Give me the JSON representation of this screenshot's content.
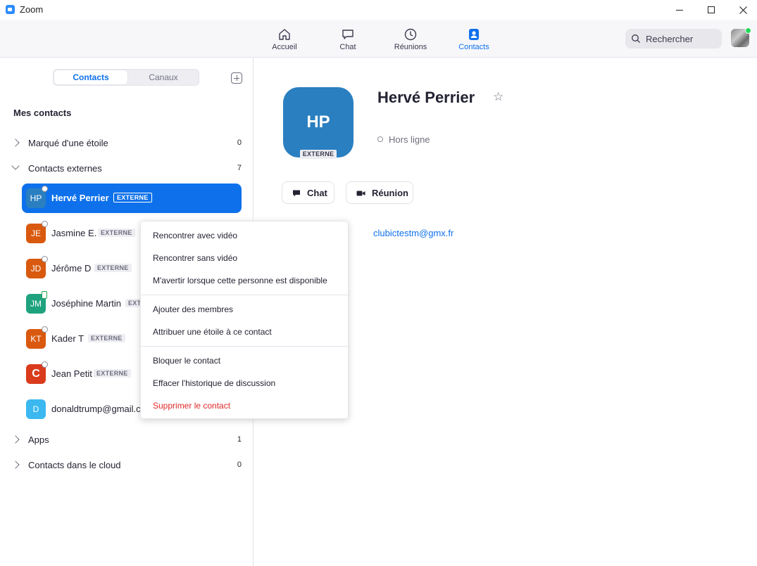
{
  "window": {
    "title": "Zoom"
  },
  "nav": {
    "tabs": [
      {
        "label": "Accueil",
        "icon": "home-icon"
      },
      {
        "label": "Chat",
        "icon": "chat-icon"
      },
      {
        "label": "Réunions",
        "icon": "clock-icon"
      },
      {
        "label": "Contacts",
        "icon": "contacts-icon",
        "active": true
      }
    ],
    "search_label": "Rechercher"
  },
  "sidebar": {
    "segments": [
      "Contacts",
      "Canaux"
    ],
    "section_title": "Mes contacts",
    "groups": {
      "starred": {
        "label": "Marqué d'une étoile",
        "count": "0"
      },
      "external": {
        "label": "Contacts externes",
        "count": "7"
      },
      "apps": {
        "label": "Apps",
        "count": "1"
      },
      "cloud": {
        "label": "Contacts dans le cloud",
        "count": "0"
      }
    },
    "contacts": [
      {
        "initials": "HP",
        "name": "Hervé Perrier",
        "tag": "EXTERNE",
        "color": "#2a7fc0"
      },
      {
        "initials": "JE",
        "name": "Jasmine E.",
        "tag": "EXTERNE",
        "color": "#d9590f"
      },
      {
        "initials": "JD",
        "name": "Jérôme D",
        "tag": "EXTERNE",
        "color": "#d9590f"
      },
      {
        "initials": "JM",
        "name": "Joséphine Martin",
        "tag": "EXT",
        "color": "#1fa37f"
      },
      {
        "initials": "KT",
        "name": "Kader T",
        "tag": "EXTERNE",
        "color": "#d9590f"
      },
      {
        "initials": "C",
        "name": "Jean Petit",
        "tag": "EXTERNE",
        "color": "#d93b1c"
      },
      {
        "initials": "D",
        "name": "donaldtrump@gmail.c",
        "tag": "",
        "color": "#3bb8f0"
      }
    ]
  },
  "profile": {
    "initials": "HP",
    "tag": "EXTERNE",
    "name": "Hervé Perrier",
    "presence": "Hors ligne",
    "chat_button": "Chat",
    "meeting_button": "Réunion",
    "email": "clubictestm@gmx.fr"
  },
  "context_menu": {
    "items": [
      "Rencontrer avec vidéo",
      "Rencontrer sans vidéo",
      "M'avertir lorsque cette personne est disponible",
      "Ajouter des membres",
      "Attribuer une étoile à ce contact",
      "Bloquer le contact",
      "Effacer l'historique de discussion",
      "Supprimer le contact"
    ]
  },
  "colors": {
    "accent": "#0e71eb",
    "danger": "#e02828",
    "online": "#23d959"
  }
}
